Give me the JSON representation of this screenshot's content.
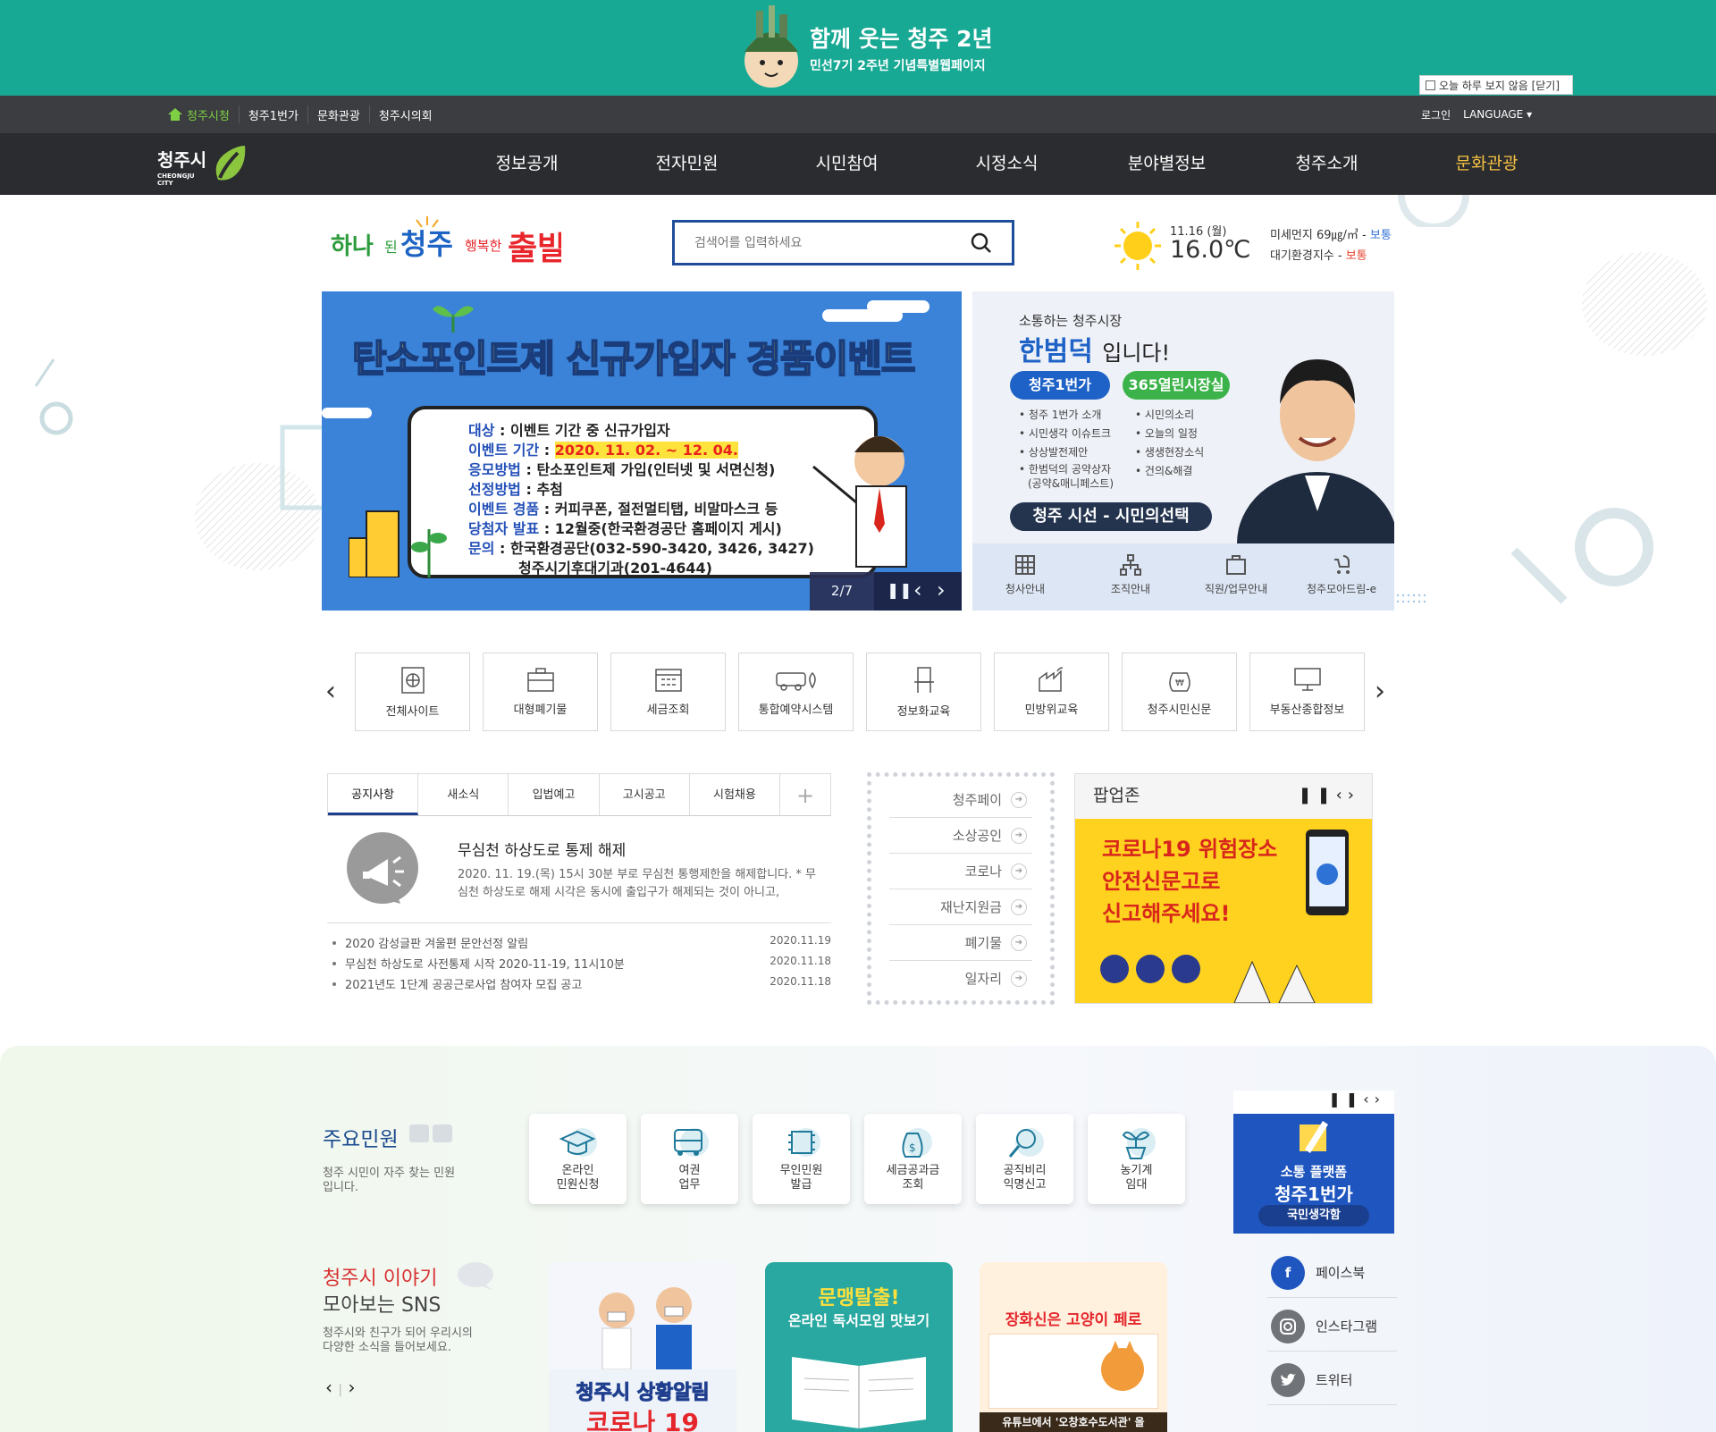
{
  "banner": {
    "title": "함께 웃는 청주 2년",
    "subtitle": "민선7기 2주년 기념특별웹페이지",
    "close_label": "오늘 하루 보지 않음 [닫기]"
  },
  "topbar": {
    "links": [
      "청주시청",
      "청주1번가",
      "문화관광",
      "청주시의회"
    ],
    "login": "로그인",
    "language": "LANGUAGE"
  },
  "logo": {
    "korean": "청주시",
    "english_1": "CHEONGJU",
    "english_2": "CITY"
  },
  "gnb": [
    "정보공개",
    "전자민원",
    "시민참여",
    "시정소식",
    "분야별정보",
    "청주소개",
    "문화관광"
  ],
  "search": {
    "placeholder": "검색어를 입력하세요"
  },
  "weather": {
    "date": "11.16 (월)",
    "temp": "16.0℃",
    "dust_label": "미세먼지 69㎍/㎥ - ",
    "dust_status": "보통",
    "air_label": "대기환경지수 - ",
    "air_status": "보통"
  },
  "main_visual": {
    "headline": "탄소포인트제 신규가입자 경품이벤트",
    "lines": [
      {
        "key": "대상",
        "value": "이벤트 기간 중 신규가입자"
      },
      {
        "key": "이벤트 기간",
        "value": "2020. 11. 02. ~ 12. 04."
      },
      {
        "key": "응모방법",
        "value": "탄소포인트제 가입(인터넷 및 서면신청)"
      },
      {
        "key": "선정방법",
        "value": "추첨"
      },
      {
        "key": "이벤트 경품",
        "value": "커피쿠폰, 절전멀티탭, 비말마스크 등"
      },
      {
        "key": "당첨자 발표",
        "value": "12월중(한국환경공단 홈페이지 게시)"
      },
      {
        "key": "문의",
        "value": "한국환경공단(032-590-3420, 3426, 3427)"
      },
      {
        "key": "",
        "value": "청주시기후대기과(201-4644)"
      }
    ],
    "page": "2/7"
  },
  "mayor": {
    "intro": "소통하는 청주시장",
    "name": "한범덕",
    "suffix": "입니다!",
    "pill1": "청주1번가",
    "pill2": "365열린시장실",
    "list_left": [
      "청주 1번가 소개",
      "시민생각 이슈트크",
      "상상발전제안",
      "한범덕의 공약상자",
      "(공약&매니페스트)"
    ],
    "list_right": [
      "시민의소리",
      "오늘의 일정",
      "생생현장소식",
      "건의&해결"
    ],
    "vision": "청주 시선 - 시민의선택",
    "quick": [
      "청사안내",
      "조직안내",
      "직원/업무안내",
      "청주모아드림-e"
    ]
  },
  "quick_links": [
    "전체사이트",
    "대형폐기물",
    "세금조회",
    "통합예약시스템",
    "정보화교육",
    "민방위교육",
    "청주시민신문",
    "부동산종합정보"
  ],
  "notice": {
    "tabs": [
      "공지사항",
      "새소식",
      "입법예고",
      "고시공고",
      "시험채용"
    ],
    "plus": "+",
    "featured_title": "무심천 하상도로 통제 해제",
    "featured_desc": "2020. 11. 19.(목) 15시 30분 부로 무심천 통행제한을 해제합니다. * 무심천 하상도로 해제 시각은 동시에 출입구가 해제되는 것이 아니고,",
    "items": [
      {
        "title": "2020 감성글판 겨울편 문안선정 알림",
        "date": "2020.11.19"
      },
      {
        "title": "무심천 하상도로 사전통제 시작 2020-11-19, 11시10분",
        "date": "2020.11.18"
      },
      {
        "title": "2021년도 1단계 공공근로사업 참여자 모집 공고",
        "date": "2020.11.18"
      }
    ]
  },
  "keywords": [
    "청주페이",
    "소상공인",
    "코로나",
    "재난지원금",
    "폐기물",
    "일자리"
  ],
  "popup": {
    "title": "팝업존",
    "line1": "코로나19 위험장소",
    "line2": "안전신문고로",
    "line3": "신고해주세요!"
  },
  "minwon": {
    "title": "주요민원",
    "desc": "청주 시민이 자주 찾는 민원입니다.",
    "items": [
      [
        "온라인",
        "민원신청"
      ],
      [
        "여권",
        "업무"
      ],
      [
        "무인민원",
        "발급"
      ],
      [
        "세금공과금",
        "조회"
      ],
      [
        "공직비리",
        "익명신고"
      ],
      [
        "농기계",
        "임대"
      ]
    ]
  },
  "side_promo": {
    "line1": "소통 플랫폼",
    "line2": "청주1번가",
    "button": "국민생각함"
  },
  "story": {
    "title": "청주시 이야기",
    "subtitle": "모아보는 SNS",
    "desc": "청주시와 친구가 되어 우리시의 다양한 소식을 들어보세요."
  },
  "sns_cards": [
    {
      "title": "청주시 상황알림",
      "sub": "코로나 19"
    },
    {
      "title": "문맹탈출!",
      "sub": "온라인 독서모임 맛보기"
    },
    {
      "title": "장화신은 고양이 페로",
      "sub": "유튜브에서 '오창호수도서관' 을"
    }
  ],
  "social": [
    "페이스북",
    "인스타그램",
    "트위터"
  ],
  "colors": {
    "banner": "#17a994",
    "gnb": "#2b2c2f",
    "accent": "#1e4d9b",
    "culture": "#f6c343"
  }
}
